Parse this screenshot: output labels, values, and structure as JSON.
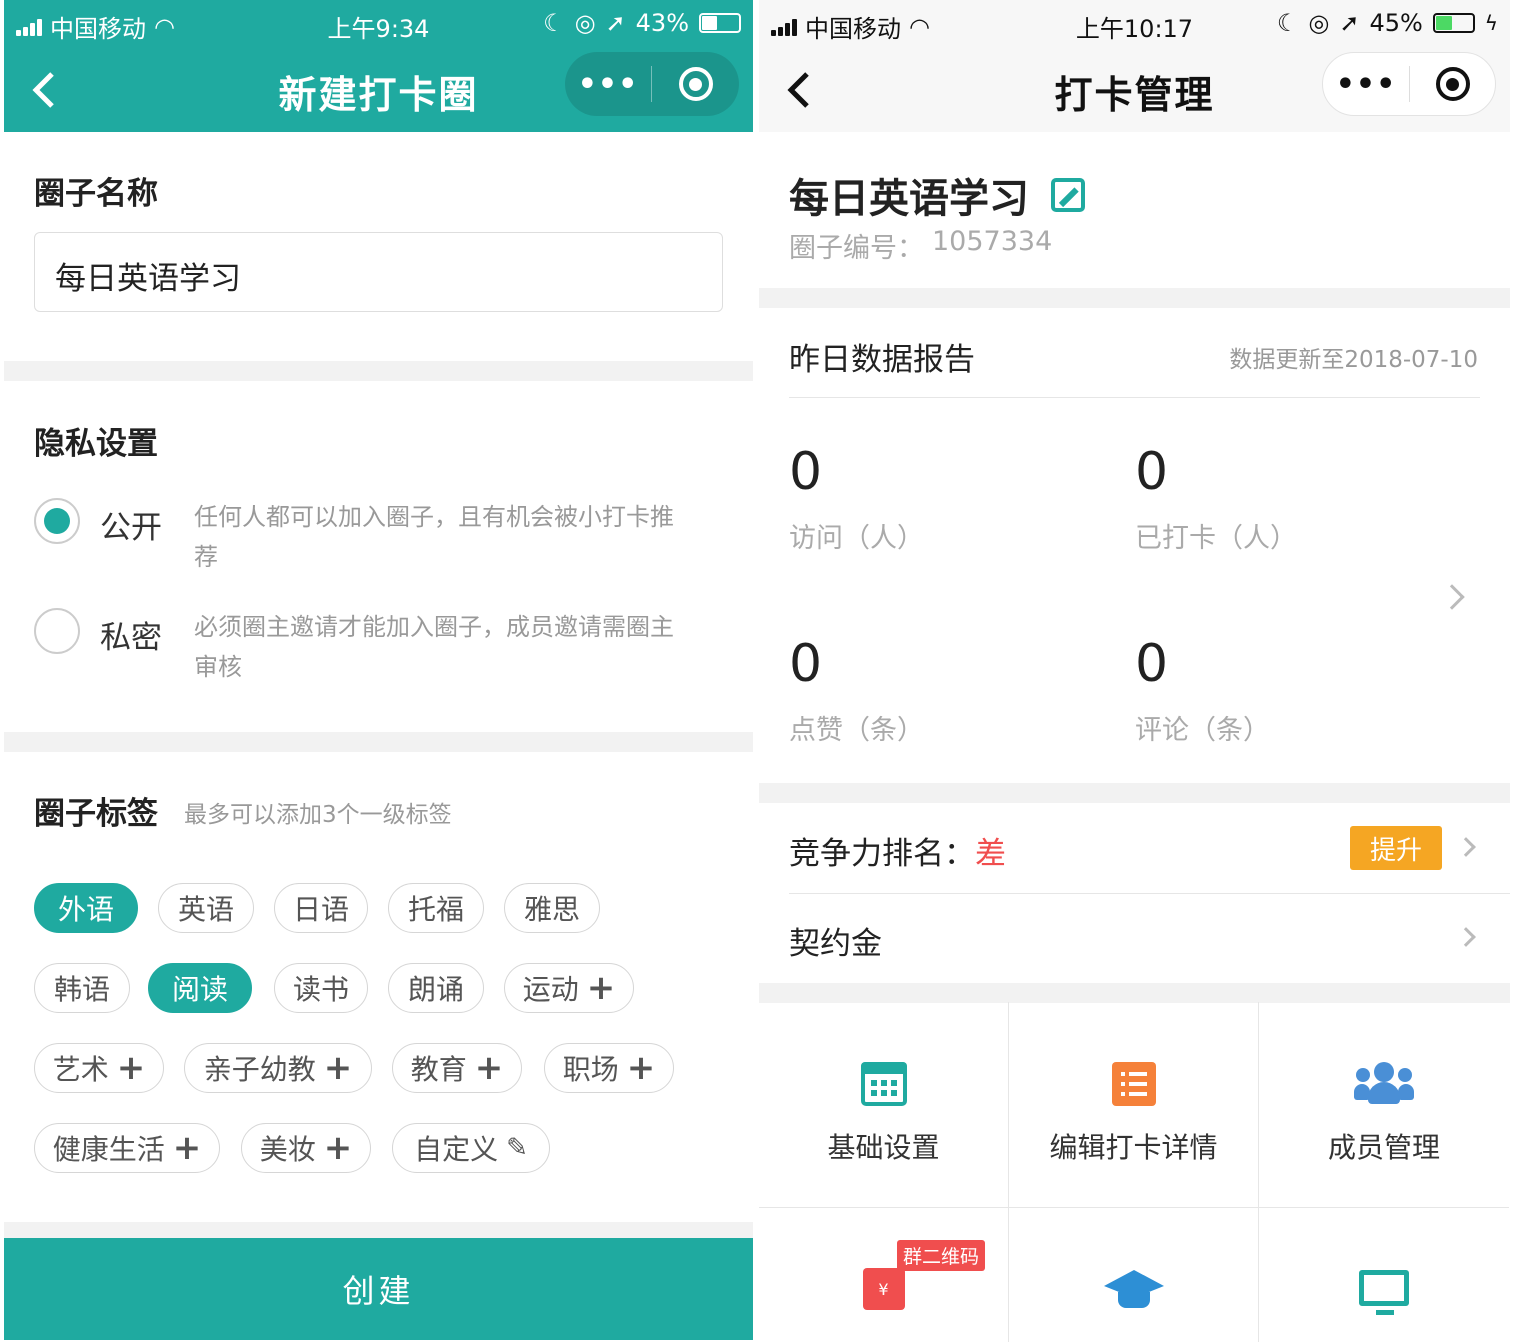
{
  "left": {
    "status": {
      "carrier": "中国移动",
      "time": "上午9:34",
      "battery": "43%",
      "battery_level": 0.43
    },
    "nav": {
      "title": "新建打卡圈",
      "more": "•••"
    },
    "name_section": {
      "label": "圈子名称",
      "value": "每日英语学习"
    },
    "privacy": {
      "label": "隐私设置",
      "options": [
        {
          "label": "公开",
          "desc": "任何人都可以加入圈子，且有机会被小打卡推荐",
          "selected": true
        },
        {
          "label": "私密",
          "desc": "必须圈主邀请才能加入圈子，成员邀请需圈主审核",
          "selected": false
        }
      ]
    },
    "tags": {
      "label": "圈子标签",
      "hint": "最多可以添加3个一级标签",
      "items": [
        {
          "text": "外语",
          "selected": true
        },
        {
          "text": "英语",
          "selected": false
        },
        {
          "text": "日语",
          "selected": false
        },
        {
          "text": "托福",
          "selected": false
        },
        {
          "text": "雅思",
          "selected": false
        },
        {
          "text": "韩语",
          "selected": false
        },
        {
          "text": "阅读",
          "selected": true
        },
        {
          "text": "读书",
          "selected": false
        },
        {
          "text": "朗诵",
          "selected": false
        },
        {
          "text": "运动",
          "selected": false,
          "icon": "plus-icon"
        },
        {
          "text": "艺术",
          "selected": false,
          "icon": "plus-icon"
        },
        {
          "text": "亲子幼教",
          "selected": false,
          "icon": "plus-icon"
        },
        {
          "text": "教育",
          "selected": false,
          "icon": "plus-icon"
        },
        {
          "text": "职场",
          "selected": false,
          "icon": "plus-icon"
        },
        {
          "text": "健康生活",
          "selected": false,
          "icon": "plus-icon"
        },
        {
          "text": "美妆",
          "selected": false,
          "icon": "plus-icon"
        },
        {
          "text": "自定义",
          "selected": false,
          "icon": "pencil-icon"
        }
      ]
    },
    "create_button": "创建",
    "colors": {
      "primary": "#1faaa0"
    }
  },
  "right": {
    "status": {
      "carrier": "中国移动",
      "time": "上午10:17",
      "battery": "45%",
      "battery_level": 0.45
    },
    "nav": {
      "title": "打卡管理",
      "more": "•••"
    },
    "circle": {
      "name": "每日英语学习",
      "id_label": "圈子编号：",
      "id_value": "1057334"
    },
    "report": {
      "title": "昨日数据报告",
      "updated": "数据更新至2018-07-10",
      "stats": [
        {
          "value": "0",
          "label": "访问（人）"
        },
        {
          "value": "0",
          "label": "已打卡（人）"
        },
        {
          "value": "0",
          "label": "点赞（条）"
        },
        {
          "value": "0",
          "label": "评论（条）"
        }
      ]
    },
    "rank": {
      "label": "竞争力排名：",
      "value": "差",
      "button": "提升"
    },
    "deposit": {
      "label": "契约金"
    },
    "grid": [
      {
        "label": "基础设置",
        "icon": "calendar-icon"
      },
      {
        "label": "编辑打卡详情",
        "icon": "list-icon"
      },
      {
        "label": "成员管理",
        "icon": "users-icon"
      },
      {
        "label": "",
        "icon": "red-packet-icon",
        "badge": "群二维码"
      },
      {
        "label": "",
        "icon": "graduation-cap-icon"
      },
      {
        "label": "",
        "icon": "monitor-icon"
      }
    ]
  }
}
